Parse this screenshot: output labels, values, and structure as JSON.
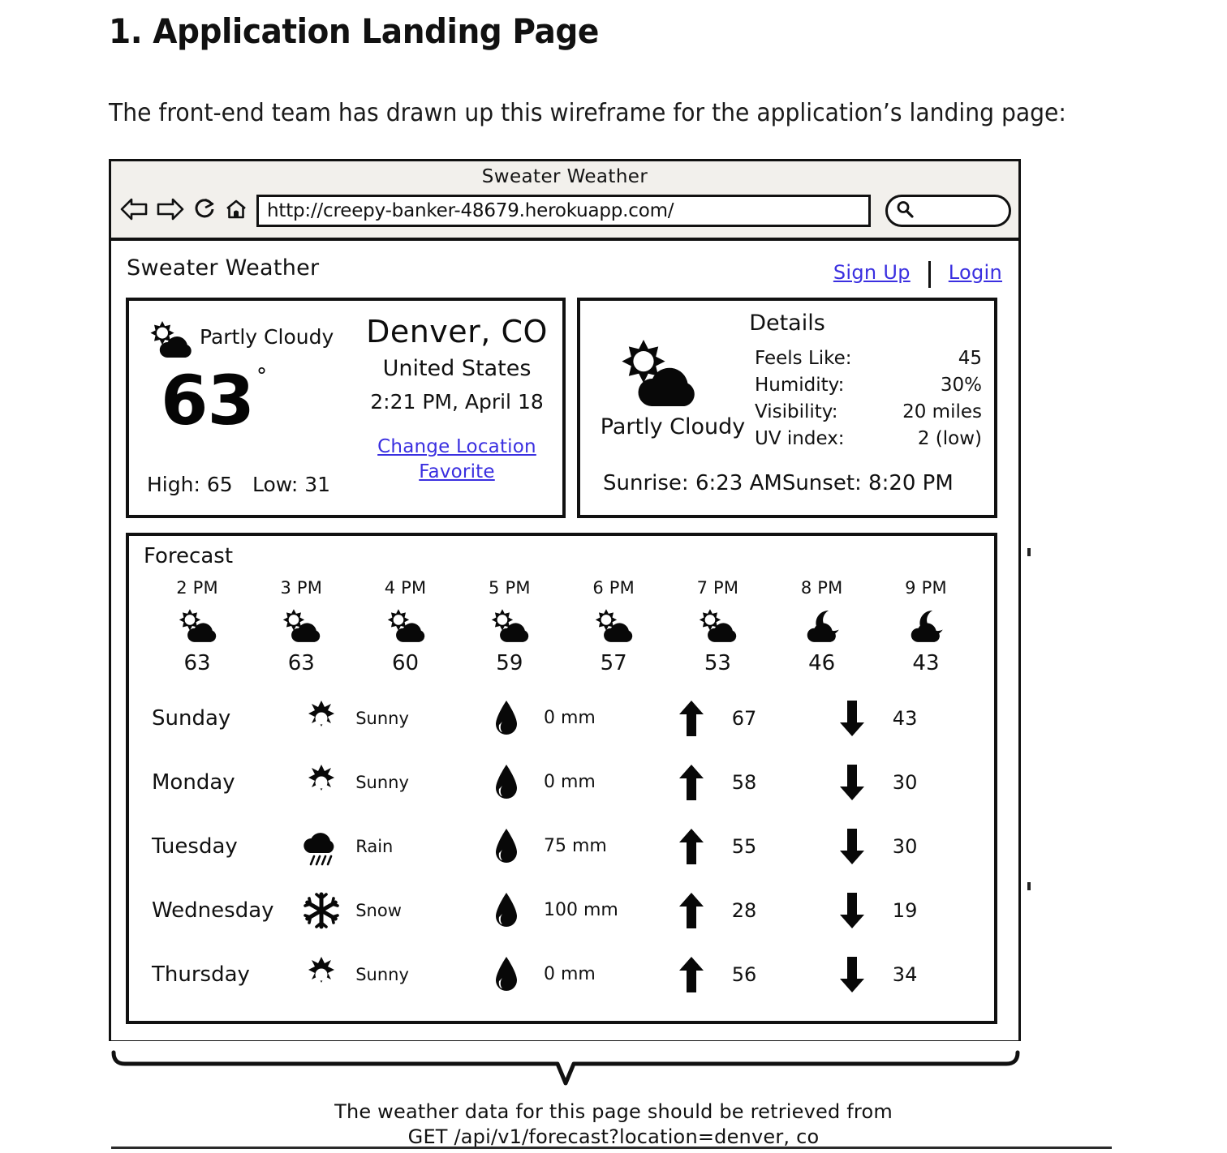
{
  "document": {
    "heading": "1. Application Landing Page",
    "intro": "The front-end team has drawn up this wireframe for the application’s landing page:"
  },
  "browser": {
    "window_title": "Sweater Weather",
    "url": "http://creepy-banker-48679.herokuapp.com/",
    "search_placeholder": "",
    "controls": [
      "back-icon",
      "forward-icon",
      "reload-icon",
      "home-icon",
      "search-icon"
    ]
  },
  "site": {
    "brand": "Sweater Weather",
    "sign_up": "Sign Up",
    "login": "Login"
  },
  "current": {
    "condition": "Partly Cloudy",
    "condition_icon": "sun-behind-cloud-icon",
    "temperature": "63",
    "degree": "°",
    "high": "High: 65",
    "low": "Low: 31",
    "city": "Denver, CO",
    "country": "United States",
    "datetime": "2:21 PM, April 18",
    "change_location": "Change Location",
    "favorite": "Favorite"
  },
  "details": {
    "title": "Details",
    "condition": "Partly Cloudy",
    "condition_icon": "sun-behind-cloud-icon",
    "rows": [
      {
        "key": "Feels Like:",
        "value": "45"
      },
      {
        "key": "Humidity:",
        "value": "30%"
      },
      {
        "key": "Visibility:",
        "value": "20 miles"
      },
      {
        "key": "UV index:",
        "value": "2 (low)"
      }
    ],
    "sunrise": "Sunrise: 6:23 AM",
    "sunset": "Sunset: 8:20 PM"
  },
  "forecast": {
    "title": "Forecast",
    "hourly": [
      {
        "time": "2 PM",
        "icon": "sun-behind-cloud-icon",
        "temp": "63"
      },
      {
        "time": "3 PM",
        "icon": "sun-behind-cloud-icon",
        "temp": "63"
      },
      {
        "time": "4 PM",
        "icon": "sun-behind-cloud-icon",
        "temp": "60"
      },
      {
        "time": "5 PM",
        "icon": "sun-behind-cloud-icon",
        "temp": "59"
      },
      {
        "time": "6 PM",
        "icon": "sun-behind-cloud-icon",
        "temp": "57"
      },
      {
        "time": "7 PM",
        "icon": "sun-behind-cloud-icon",
        "temp": "53"
      },
      {
        "time": "8 PM",
        "icon": "moon-behind-cloud-icon",
        "temp": "46"
      },
      {
        "time": "9 PM",
        "icon": "moon-behind-cloud-icon",
        "temp": "43"
      }
    ],
    "daily": [
      {
        "day": "Sunday",
        "icon": "sun-icon",
        "condition": "Sunny",
        "precip": "0 mm",
        "high": "67",
        "low": "43"
      },
      {
        "day": "Monday",
        "icon": "sun-icon",
        "condition": "Sunny",
        "precip": "0 mm",
        "high": "58",
        "low": "30"
      },
      {
        "day": "Tuesday",
        "icon": "rain-cloud-icon",
        "condition": "Rain",
        "precip": "75 mm",
        "high": "55",
        "low": "30"
      },
      {
        "day": "Wednesday",
        "icon": "snowflake-icon",
        "condition": "Snow",
        "precip": "100 mm",
        "high": "28",
        "low": "19"
      },
      {
        "day": "Thursday",
        "icon": "sun-icon",
        "condition": "Sunny",
        "precip": "0 mm",
        "high": "56",
        "low": "34"
      }
    ],
    "precip_icon": "water-drop-icon",
    "high_icon": "arrow-up-icon",
    "low_icon": "arrow-down-icon"
  },
  "annotation": {
    "line1": "The weather data for this page should be retrieved from",
    "line2": "GET /api/v1/forecast?location=denver, co"
  },
  "colors": {
    "link": "#3a2fe0",
    "ink": "#111111",
    "chrome": "#f2f0ec"
  }
}
